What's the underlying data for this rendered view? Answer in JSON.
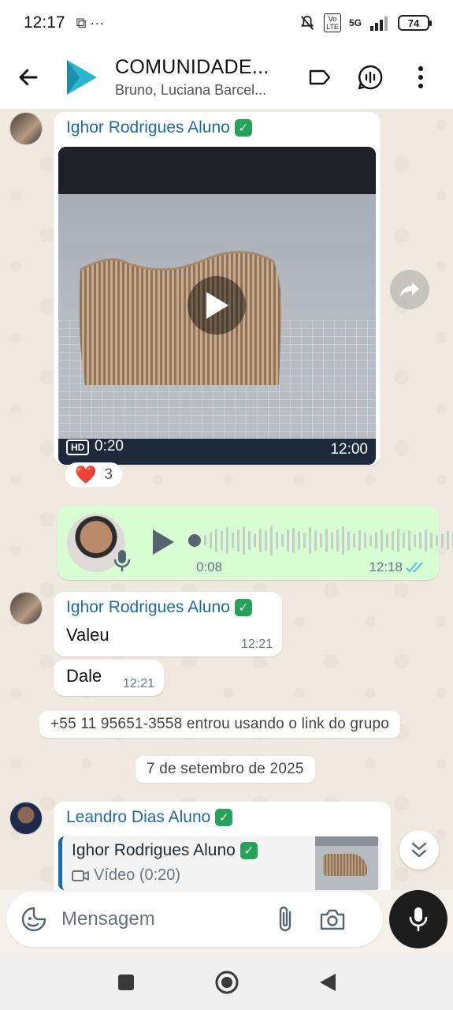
{
  "status_bar": {
    "time": "12:17",
    "notif_icons": "⧉ ···",
    "signal_label": "5G",
    "volte": "Vo LTE",
    "battery": "74"
  },
  "header": {
    "title": "COMUNIDADE...",
    "subtitle": "Bruno, Luciana Barcel..."
  },
  "messages": {
    "video_msg": {
      "sender": "Ighor Rodrigues Aluno",
      "duration": "0:20",
      "hd_label": "HD",
      "time": "12:00",
      "reaction_emoji": "❤️",
      "reaction_count": "3"
    },
    "voice_msg": {
      "duration": "0:08",
      "time": "12:18"
    },
    "text_group": {
      "sender": "Ighor Rodrigues Aluno",
      "msg1_text": "Valeu",
      "msg1_time": "12:21",
      "msg2_text": "Dale",
      "msg2_time": "12:21"
    },
    "system_join": "+55 11 95651-3558 entrou usando o link do grupo",
    "date_divider": "7 de setembro de 2025",
    "reply_msg": {
      "sender": "Leandro Dias Aluno",
      "quote_sender": "Ighor Rodrigues Aluno",
      "quote_body": "Vídeo (0:20)"
    }
  },
  "input": {
    "placeholder": "Mensagem"
  },
  "colors": {
    "accent_blue": "#1d6aa8",
    "outgoing_bubble": "#d9fdd3",
    "verified_green": "#25a35a",
    "chat_bg": "#efe9df"
  },
  "icons": {
    "back": "arrow-left-icon",
    "label": "tag-icon",
    "voice_chat": "voice-chat-icon",
    "menu": "more-vertical-icon",
    "forward": "forward-icon",
    "scroll_down": "double-chevron-down-icon",
    "emoji": "sticker-icon",
    "attach": "paperclip-icon",
    "camera": "camera-icon",
    "mic": "mic-icon"
  }
}
